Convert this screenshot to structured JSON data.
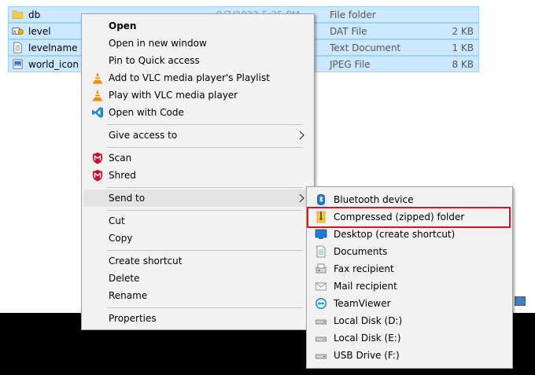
{
  "files": [
    {
      "name": "db",
      "date": "9/7/2022 5:35 PM",
      "type": "File folder",
      "size": "",
      "icon": "folder-icon"
    },
    {
      "name": "level",
      "date": "",
      "type": "DAT File",
      "size": "2 KB",
      "icon": "dat-file-icon"
    },
    {
      "name": "levelname",
      "date": "",
      "type": "Text Document",
      "size": "1 KB",
      "icon": "text-file-icon"
    },
    {
      "name": "world_icon",
      "date": "",
      "type": "JPEG File",
      "size": "8 KB",
      "icon": "image-file-icon"
    }
  ],
  "context_menu": {
    "open": "Open",
    "open_new_window": "Open in new window",
    "pin_quick_access": "Pin to Quick access",
    "vlc_add_playlist": "Add to VLC media player's Playlist",
    "vlc_play": "Play with VLC media player",
    "open_with_code": "Open with Code",
    "give_access_to": "Give access to",
    "scan": "Scan",
    "shred": "Shred",
    "send_to": "Send to",
    "cut": "Cut",
    "copy": "Copy",
    "create_shortcut": "Create shortcut",
    "delete": "Delete",
    "rename": "Rename",
    "properties": "Properties"
  },
  "send_to_menu": {
    "bluetooth": "Bluetooth device",
    "compressed": "Compressed (zipped) folder",
    "desktop": "Desktop (create shortcut)",
    "documents": "Documents",
    "fax": "Fax recipient",
    "mail": "Mail recipient",
    "teamviewer": "TeamViewer",
    "disk_d": "Local Disk (D:)",
    "disk_e": "Local Disk (E:)",
    "usb_f": "USB Drive (F:)"
  },
  "colors": {
    "selection": "#cce8ff",
    "menu_bg": "#f2f2f2",
    "highlight_border": "#d9161b",
    "vlc_orange": "#f08c00",
    "vscode_blue": "#1f8ad2",
    "mcafee_red": "#c8102e"
  }
}
